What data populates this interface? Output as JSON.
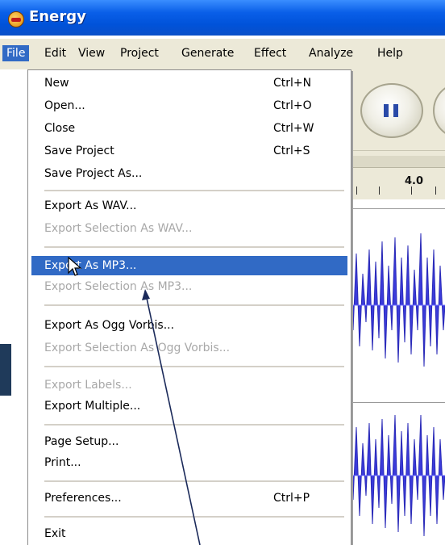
{
  "window": {
    "title": "Energy"
  },
  "menubar": {
    "items": [
      {
        "label": "File",
        "active": true
      },
      {
        "label": "Edit"
      },
      {
        "label": "View"
      },
      {
        "label": "Project"
      },
      {
        "label": "Generate"
      },
      {
        "label": "Effect"
      },
      {
        "label": "Analyze"
      },
      {
        "label": "Help"
      }
    ]
  },
  "file_menu": {
    "items": [
      {
        "label": "New",
        "shortcut": "Ctrl+N"
      },
      {
        "label": "Open...",
        "shortcut": "Ctrl+O"
      },
      {
        "label": "Close",
        "shortcut": "Ctrl+W"
      },
      {
        "label": "Save Project",
        "shortcut": "Ctrl+S"
      },
      {
        "label": "Save Project As..."
      },
      {
        "label": "Export As WAV..."
      },
      {
        "label": "Export Selection As WAV...",
        "disabled": true
      },
      {
        "label": "Export As MP3...",
        "highlighted": true
      },
      {
        "label": "Export Selection As MP3...",
        "disabled": true
      },
      {
        "label": "Export As Ogg Vorbis..."
      },
      {
        "label": "Export Selection As Ogg Vorbis...",
        "disabled": true
      },
      {
        "label": "Export Labels...",
        "disabled": true
      },
      {
        "label": "Export Multiple..."
      },
      {
        "label": "Page Setup..."
      },
      {
        "label": "Print..."
      },
      {
        "label": "Preferences...",
        "shortcut": "Ctrl+P"
      },
      {
        "label": "Exit"
      }
    ]
  },
  "timeline": {
    "ruler_label": "4.0"
  },
  "colors": {
    "titlebar": "#0052d9",
    "highlight": "#316ac5",
    "waveform": "#3b3bdb",
    "annotation_line": "#1b2a5a"
  },
  "icons": [
    "app-icon",
    "pause-icon",
    "cursor-icon"
  ]
}
